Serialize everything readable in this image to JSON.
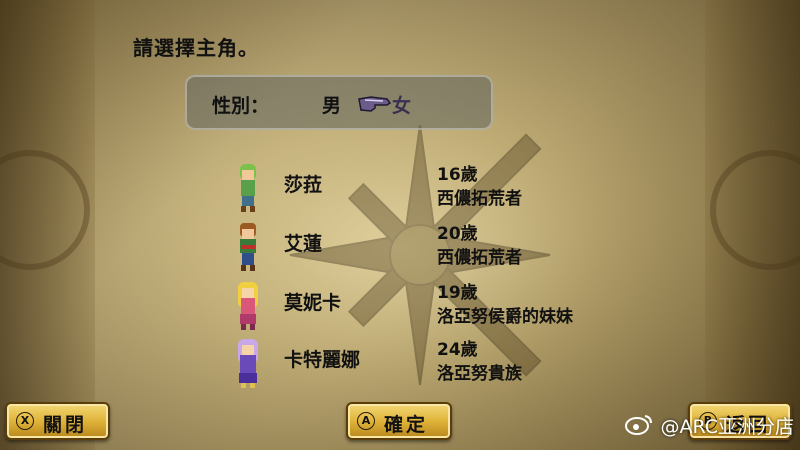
{
  "prompt": "請選擇主角。",
  "gender": {
    "label": "性別：",
    "male": "男",
    "female": "女",
    "selected": "女"
  },
  "characters": [
    {
      "name": "莎菈",
      "age": "16歲",
      "origin": "西儂拓荒者"
    },
    {
      "name": "艾蓮",
      "age": "20歲",
      "origin": "西儂拓荒者"
    },
    {
      "name": "莫妮卡",
      "age": "19歲",
      "origin": "洛亞努侯爵的妹妹"
    },
    {
      "name": "卡特麗娜",
      "age": "24歲",
      "origin": "洛亞努貴族"
    }
  ],
  "buttons": {
    "close": {
      "icon": "X",
      "label": "關閉"
    },
    "confirm": {
      "icon": "A",
      "label": "確定"
    },
    "back": {
      "icon": "B",
      "label": "返回"
    }
  },
  "watermark": "@ARC亚洲分店",
  "icons": {
    "pointer": "pointing-hand-icon",
    "weibo": "weibo-icon"
  }
}
